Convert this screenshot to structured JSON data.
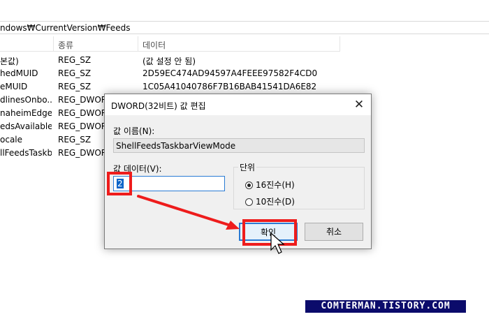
{
  "address": {
    "path": "ndows₩CurrentVersion₩Feeds"
  },
  "columns": {
    "name": "",
    "type": "종류",
    "data": "데이터"
  },
  "rows": [
    {
      "name": "본값)",
      "type": "REG_SZ",
      "data": "(값 설정 안 됨)"
    },
    {
      "name": "hedMUID",
      "type": "REG_SZ",
      "data": "2D59EC474AD94597A4FEEE97582F4CD0"
    },
    {
      "name": "eMUID",
      "type": "REG_SZ",
      "data": "1C05A41040786F7B16BAB41541DA6E82"
    },
    {
      "name": "dlinesOnbo...",
      "type": "REG_DWORD",
      "data": ""
    },
    {
      "name": "naheimEdgel...",
      "type": "REG_DWORD",
      "data": ""
    },
    {
      "name": "edsAvailable",
      "type": "REG_DWORD",
      "data": ""
    },
    {
      "name": "ocale",
      "type": "REG_SZ",
      "data": ""
    },
    {
      "name": "llFeedsTaskb...",
      "type": "REG_DWORD",
      "data": ""
    }
  ],
  "dialog": {
    "title": "DWORD(32비트) 값 편집",
    "close_glyph": "✕",
    "name_label": "값 이름(N):",
    "name_value": "ShellFeedsTaskbarViewMode",
    "data_label": "값 데이터(V):",
    "data_value": "2",
    "base_label": "단위",
    "hex_label": "16진수(H)",
    "dec_label": "10진수(D)",
    "selected_base": "hex",
    "ok_label": "확인",
    "cancel_label": "취소"
  },
  "watermark": {
    "text": "COMTERMAN.TISTORY.COM"
  },
  "colors": {
    "annotation_red": "#ee1c1c",
    "accent_blue": "#2a7bd4",
    "watermark_bg": "#0b0b6b"
  }
}
